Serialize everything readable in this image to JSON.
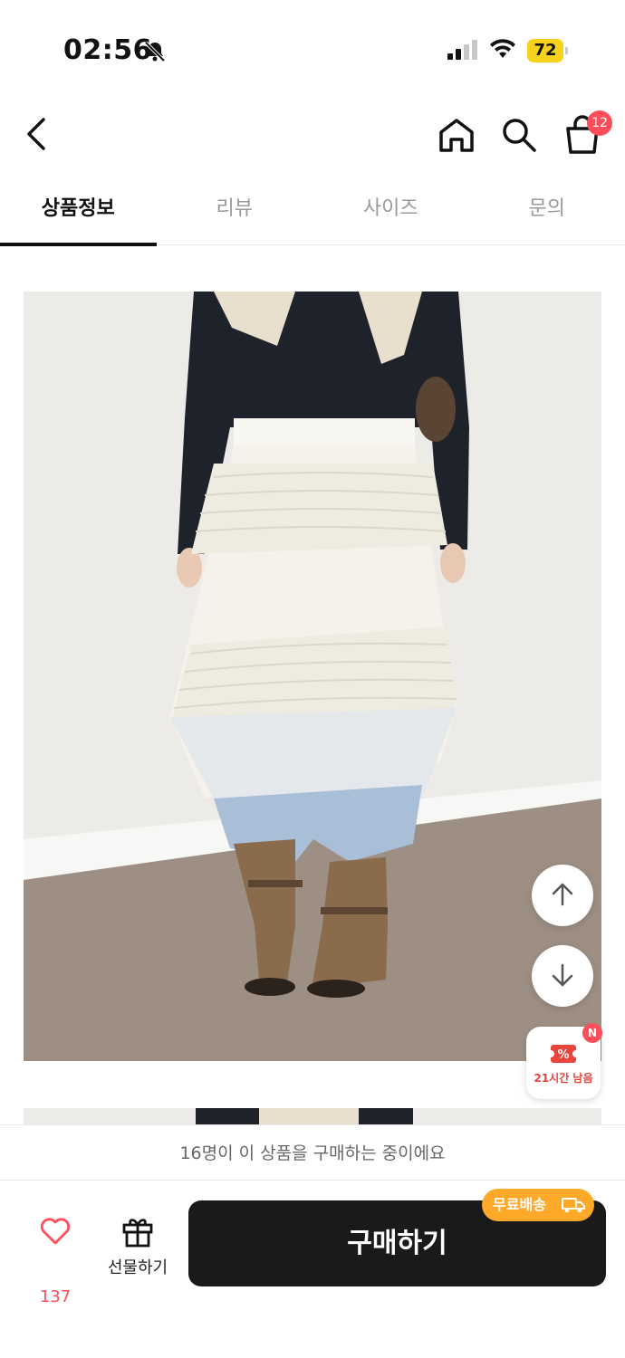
{
  "status_bar": {
    "time": "02:56",
    "battery": "72"
  },
  "nav": {
    "cart_count": "12"
  },
  "tabs": [
    {
      "label": "상품정보",
      "active": true
    },
    {
      "label": "리뷰",
      "active": false
    },
    {
      "label": "사이즈",
      "active": false
    },
    {
      "label": "문의",
      "active": false
    }
  ],
  "coupon": {
    "badge": "N",
    "text": "21시간 남음"
  },
  "notice": "16명이 이 상품을 구매하는 중이에요",
  "bottom": {
    "like_count": "137",
    "gift_label": "선물하기",
    "buy_label": "구매하기",
    "free_shipping": "무료배송"
  },
  "colors": {
    "accent_red": "#ff4d5a",
    "buy_button": "#1a1a1a",
    "free_shipping": "#ffa92a",
    "battery": "#f7d21c"
  }
}
